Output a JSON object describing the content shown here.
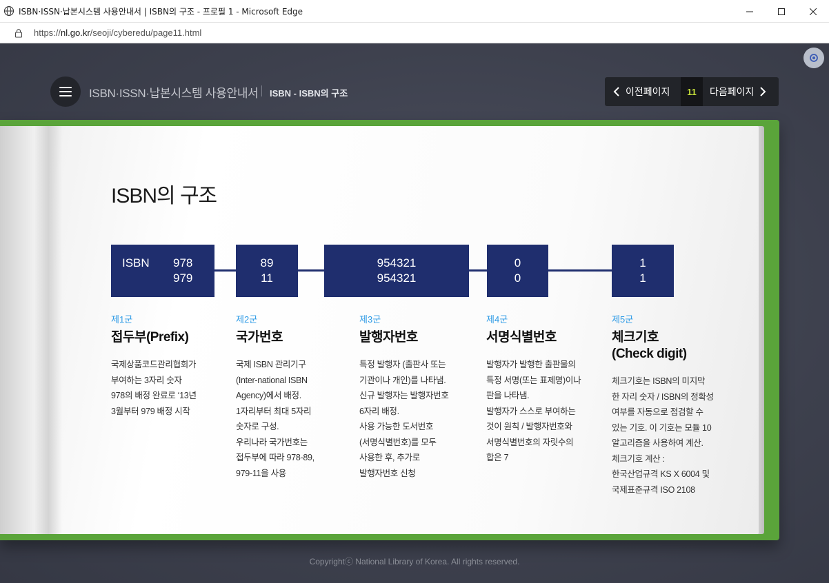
{
  "window": {
    "title": "ISBN·ISSN·납본시스템 사용안내서 | ISBN의 구조 - 프로필 1 - Microsoft Edge"
  },
  "address": {
    "url_prefix": "https://",
    "url_host": "nl.go.kr",
    "url_path": "/seoji/cyberedu/page11.html"
  },
  "header": {
    "site_title": "ISBN·ISSN·납본시스템 사용안내서",
    "breadcrumb": "ISBN - ISBN의 구조",
    "prev_label": "이전페이지",
    "page_number": "11",
    "next_label": "다음페이지"
  },
  "content": {
    "title": "ISBN의 구조",
    "boxes": [
      {
        "label": "ISBN",
        "line1": "978",
        "line2": "979"
      },
      {
        "line1": "89",
        "line2": "11"
      },
      {
        "line1": "954321",
        "line2": "954321"
      },
      {
        "line1": "0",
        "line2": "0"
      },
      {
        "line1": "1",
        "line2": "1"
      }
    ],
    "groups": [
      {
        "group": "제1군",
        "name": "접두부(Prefix)",
        "name2": "",
        "desc": [
          "국제상품코드관리협회가",
          "부여하는 3자리 숫자",
          "978의 배정 완료로 ‘13년",
          "3월부터 979 배정 시작"
        ]
      },
      {
        "group": "제2군",
        "name": "국가번호",
        "name2": "",
        "desc": [
          "국제 ISBN 관리기구",
          "(Inter-national ISBN",
          "Agency)에서 배정.",
          "1자리부터 최대 5자리",
          "숫자로 구성.",
          "우리나라 국가번호는",
          "접두부에 따라 978-89,",
          "979-11을 사용"
        ]
      },
      {
        "group": "제3군",
        "name": "발행자번호",
        "name2": "",
        "desc": [
          "특정 발행자 (출판사 또는",
          "기관이나 개인)를 나타냄.",
          "신규 발행자는 발행자번호",
          "6자리 배정.",
          "사용 가능한 도서번호",
          "(서명식별번호)를 모두",
          "사용한 후, 추가로",
          "발행자번호 신청"
        ]
      },
      {
        "group": "제4군",
        "name": "서명식별번호",
        "name2": "",
        "desc": [
          "발행자가 발행한 출판물의",
          "특정 서명(또는 표제명)이나",
          "판을 나타냄.",
          "발행자가 스스로 부여하는",
          "것이 원칙 / 발행자번호와",
          "서명식별번호의 자릿수의",
          "합은 7"
        ]
      },
      {
        "group": "제5군",
        "name": "체크기호",
        "name2": "(Check digit)",
        "desc": [
          "체크기호는 ISBN의 미지막",
          "한 자리 숫자 / ISBN의 정확성",
          "여부를 자동으로 점검할 수",
          "있는 기호. 이 기호는 모듈 10",
          "알고리즘을 사용하여 계산.",
          "체크기호 계산 :",
          "한국산업규격 KS X 6004 및",
          "국제표준규격 ISO 2108"
        ]
      }
    ]
  },
  "footer": {
    "copyright": "Copyrightⓒ National Library of Korea. All rights reserved."
  },
  "colors": {
    "box_navy": "#1f2e6e",
    "group_blue": "#2e9be6",
    "cover_green": "#5aa43a",
    "page_number": "#c4de3a"
  },
  "icons": [
    "globe-icon",
    "minimize-icon",
    "maximize-icon",
    "close-icon",
    "lock-icon",
    "menu-icon",
    "chevron-left-icon",
    "chevron-right-icon",
    "settings-icon"
  ]
}
